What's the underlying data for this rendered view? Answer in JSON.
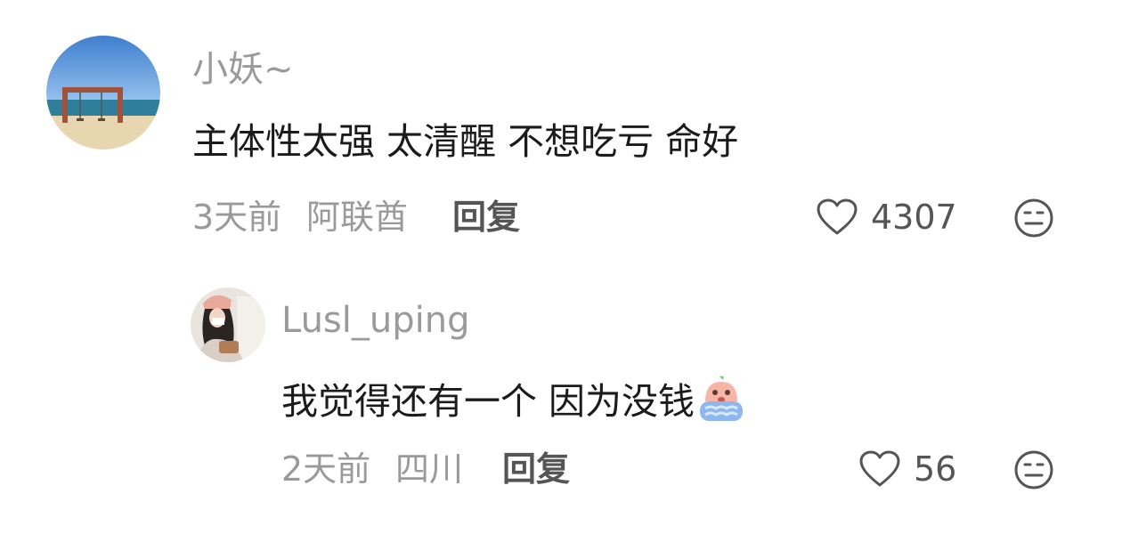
{
  "comments": [
    {
      "username": "小妖~",
      "text": "主体性太强 太清醒 不想吃亏 命好",
      "time": "3天前",
      "location": "阿联酋",
      "reply_label": "回复",
      "like_count": "4307",
      "avatar_icon": "beach-swing-avatar"
    },
    {
      "username": "Lusl_uping",
      "text": "我觉得还有一个 因为没钱",
      "emoji": "crying-emoji",
      "time": "2天前",
      "location": "四川",
      "reply_label": "回复",
      "like_count": "56",
      "avatar_icon": "girl-photo-avatar"
    }
  ],
  "icons": {
    "like": "heart-icon",
    "dislike": "meh-face-icon"
  },
  "colors": {
    "username": "#9a9a9a",
    "text": "#1b1b1b",
    "action": "#555555"
  }
}
